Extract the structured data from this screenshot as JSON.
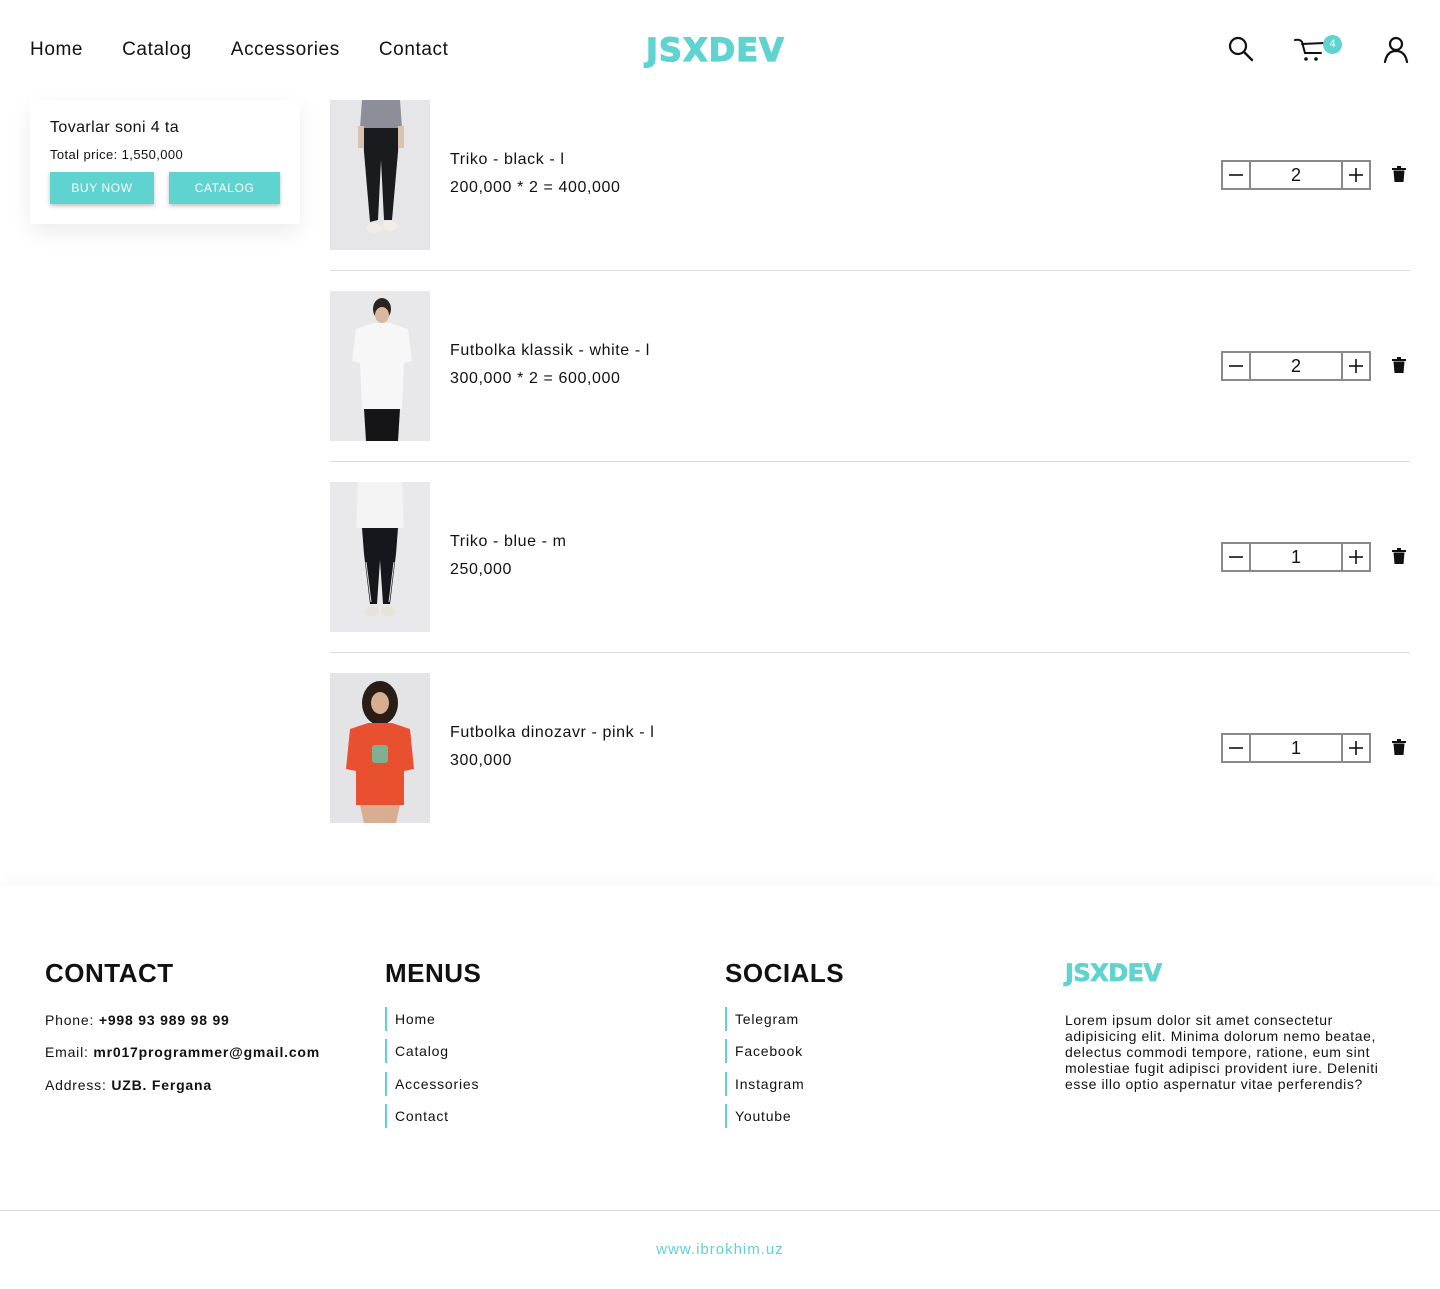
{
  "header": {
    "nav": [
      "Home",
      "Catalog",
      "Accessories",
      "Contact"
    ],
    "logo": "JSXDEV",
    "cart_count": "4"
  },
  "summary": {
    "count_text": "Tovarlar soni 4 ta",
    "total_text": "Total price: 1,550,000",
    "buy_label": "BUY NOW",
    "catalog_label": "CATALOG"
  },
  "items": [
    {
      "name": "Triko - black - l",
      "price": "200,000 * 2 = 400,000",
      "qty": "2"
    },
    {
      "name": "Futbolka klassik - white - l",
      "price": "300,000 * 2 = 600,000",
      "qty": "2"
    },
    {
      "name": "Triko - blue - m",
      "price": "250,000",
      "qty": "1"
    },
    {
      "name": "Futbolka dinozavr - pink - l",
      "price": "300,000",
      "qty": "1"
    }
  ],
  "footer": {
    "contact": {
      "title": "CONTACT",
      "phone_label": "Phone: ",
      "phone": "+998 93 989 98 99",
      "email_label": "Email: ",
      "email": "mr017programmer@gmail.com",
      "address_label": "Address: ",
      "address": "UZB. Fergana"
    },
    "menus": {
      "title": "MENUS",
      "items": [
        "Home",
        "Catalog",
        "Accessories",
        "Contact"
      ]
    },
    "socials": {
      "title": "SOCIALS",
      "items": [
        "Telegram",
        "Facebook",
        "Instagram",
        "Youtube"
      ]
    },
    "brand": {
      "logo": "JSXDEV",
      "desc": "Lorem ipsum dolor sit amet consectetur adipisicing elit. Minima dolorum nemo beatae, delectus commodi tempore, ratione, eum sint molestiae fugit adipisci provident iure. Deleniti esse illo optio aspernatur vitae perferendis?"
    },
    "site": "www.ibrokhim.uz"
  },
  "colors": {
    "accent": "#5fd3d0"
  }
}
